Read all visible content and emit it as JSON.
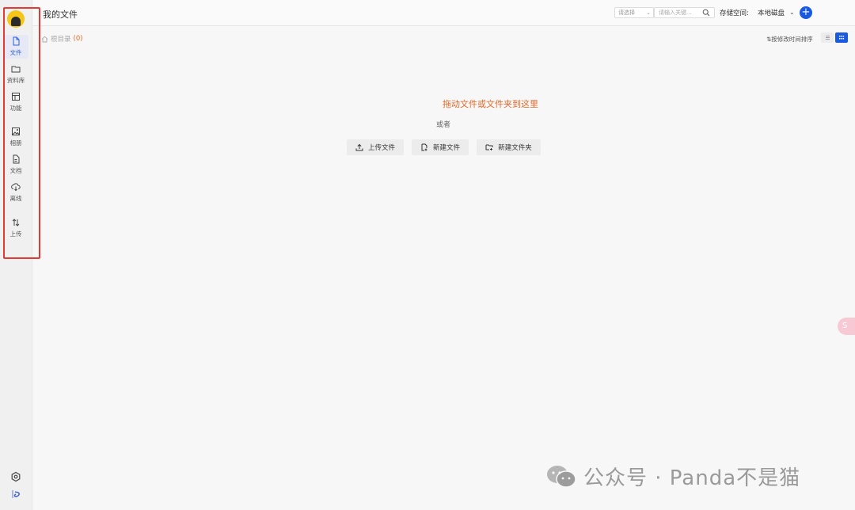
{
  "sidebar": {
    "items": [
      {
        "label": "文件",
        "icon": "file-icon",
        "active": true
      },
      {
        "label": "资料库",
        "icon": "folder-icon"
      },
      {
        "label": "功能",
        "icon": "layout-icon"
      },
      {
        "label": "相册",
        "icon": "image-icon"
      },
      {
        "label": "文档",
        "icon": "document-icon"
      },
      {
        "label": "离线",
        "icon": "cloud-download-icon"
      },
      {
        "label": "上传",
        "icon": "transfer-icon"
      }
    ],
    "bottom_icons": [
      "settings-icon",
      "brand-logo-icon"
    ]
  },
  "header": {
    "title": "我的文件",
    "select_placeholder": "请选择",
    "search_placeholder": "请输入关键...",
    "storage_label": "存储空间:",
    "storage_value": "本地磁盘"
  },
  "toolbar": {
    "breadcrumb_root": "根目录",
    "breadcrumb_count": "(0)",
    "sort_label": "⇅按修改时间排序"
  },
  "empty_state": {
    "drop_hint": "拖动文件或文件夹到这里",
    "or_text": "或者",
    "upload_file": "上传文件",
    "new_file": "新建文件",
    "new_folder": "新建文件夹"
  },
  "float_tab": "S",
  "watermark": "公众号 · Panda不是猫",
  "colors": {
    "accent": "#1a5ae0",
    "highlight": "#e26a2c",
    "annotation": "#e53935"
  }
}
